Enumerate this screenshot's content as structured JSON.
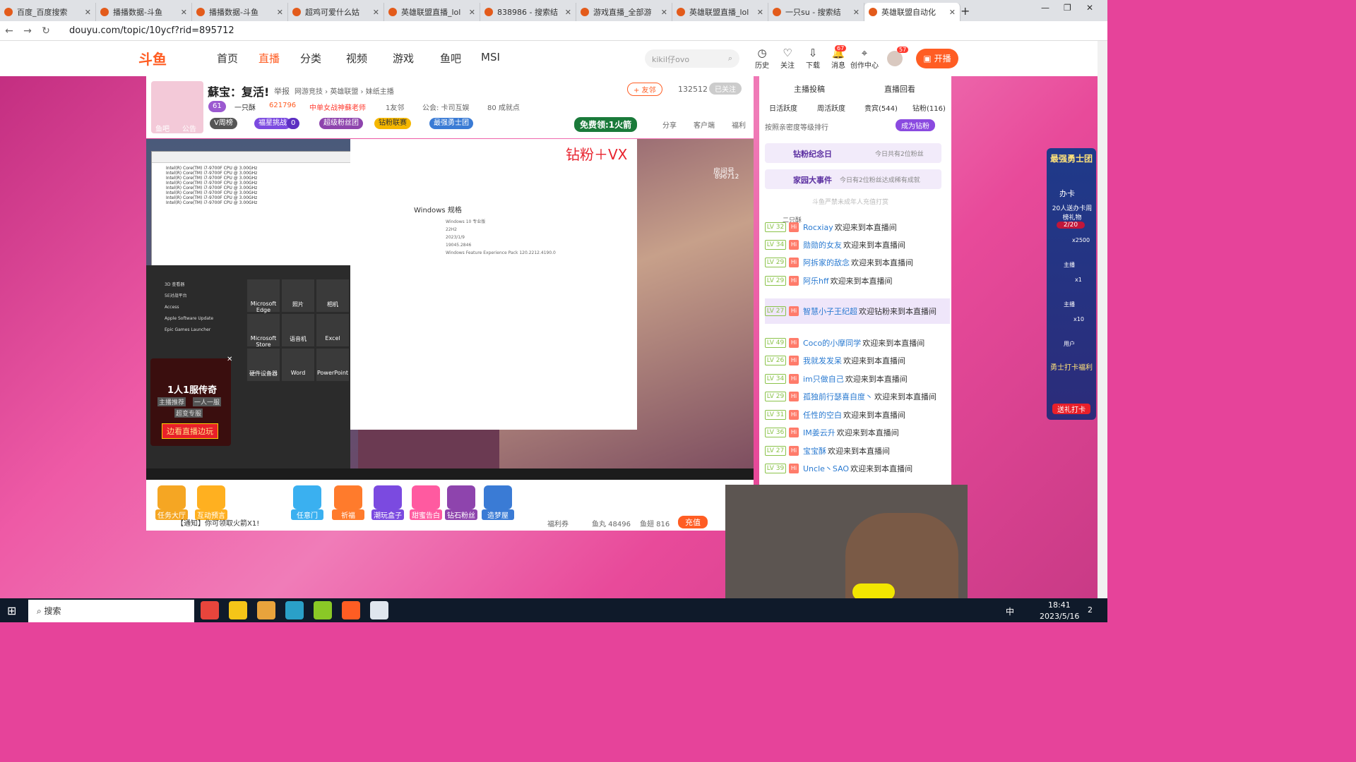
{
  "browser": {
    "tabs": [
      {
        "label": "百度_百度搜索"
      },
      {
        "label": "播播数据-斗鱼"
      },
      {
        "label": "播播数据-斗鱼"
      },
      {
        "label": "超鸡可爱什么姑"
      },
      {
        "label": "英雄联盟直播_lol"
      },
      {
        "label": "838986 - 搜索结"
      },
      {
        "label": "游戏直播_全部游"
      },
      {
        "label": "英雄联盟直播_lol"
      },
      {
        "label": "一只su - 搜索结"
      },
      {
        "label": "英雄联盟自动化"
      }
    ],
    "url": "douyu.com/topic/10ycf?rid=895712"
  },
  "topnav": {
    "logo": "斗鱼",
    "items": [
      "首页",
      "直播",
      "分类",
      "视频",
      "游戏",
      "鱼吧",
      "MSI"
    ],
    "search_placeholder": "kikiI仔ovo",
    "icons": [
      {
        "label": "历史"
      },
      {
        "label": "关注"
      },
      {
        "label": "下载"
      },
      {
        "label": "消息",
        "badge": "67"
      },
      {
        "label": "创作中心"
      }
    ],
    "avatar_badge": "57",
    "kaibo": "开播"
  },
  "room": {
    "title": "蘇宝：复活!",
    "report": "举报",
    "breadcrumb": "网游竞技 › 英雄联盟 › 妹纸主播",
    "follow_btn": "+ 友邻",
    "follow_count": "132512",
    "followed": "已关注",
    "level": "61",
    "guild": "一只酥",
    "heat": "621796",
    "tag": "中单女战神蘇老师",
    "fans": "1友邻",
    "notice": "公会: 卡司互娱",
    "achieve": "80 成就点",
    "avatar_tags": [
      "鱼吧",
      "公告"
    ],
    "badges": [
      "V周榜",
      "福星挑战",
      "0",
      "超级粉丝团",
      "钻粉联赛",
      "最强勇士团"
    ],
    "free_btn": "免费领:1火箭",
    "actions": [
      "分享",
      "客户端",
      "福利"
    ]
  },
  "video": {
    "overlay_text": "钻粉＋VX",
    "room_no_label": "房间号",
    "room_no": "896712",
    "promo_title": "1人1服传奇",
    "promo_tags": [
      "主播推荐",
      "一人一服",
      "超变专服"
    ],
    "promo_btn": "边看直播边玩",
    "win_specs_title": "Windows 规格",
    "win_specs": [
      "Windows 10 专业版",
      "22H2",
      "2023/1/9",
      "19045.2846",
      "Windows Feature Experience Pack 120.2212.4190.0"
    ],
    "start_tiles": [
      "Microsoft Edge",
      "照片",
      "相机",
      "Microsoft Store",
      "语音机",
      "Excel",
      "硬件设备器",
      "Word",
      "PowerPoint"
    ],
    "start_list": [
      "3D 查看器",
      "5E对战平台",
      "Access",
      "Apple Software Update",
      "Epic Games Launcher"
    ],
    "cpu_items": [
      "Intel(R) Core(TM) i7-9700F CPU @ 3.00GHz"
    ]
  },
  "toolbar": {
    "items": [
      "任务大厅",
      "互动预言",
      "任意门",
      "祈福",
      "潮玩盒子",
      "甜蜜告白",
      "钻石粉丝",
      "造梦屋"
    ],
    "notice": "【通知】你可领取火箭X1!",
    "welfare": "福利券",
    "fishball": "鱼丸 48496",
    "fishfin": "鱼翅 816",
    "recharge": "充值"
  },
  "panel": {
    "tabs_top": [
      "主播投稿",
      "直播回看"
    ],
    "tabs": [
      "日活跃度",
      "周活跃度",
      "贵宾(544)",
      "钻粉(116)"
    ],
    "sort_label": "按照亲密度等级排行",
    "become": "成为钻粉",
    "memorial": "钻粉纪念日",
    "memorial_note": "今日共有2位粉丝",
    "family": "家园大事件",
    "family_note": "今日有2位粉丝达成稀有成就",
    "warning": "斗鱼严禁未成年人充值打赏",
    "rank_user": "二只酥",
    "chat": [
      {
        "lv": "LV 32",
        "name": "Rocxiay",
        "msg": "欢迎来到本直播间"
      },
      {
        "lv": "LV 34",
        "name": "勋勋的女友",
        "msg": "欢迎来到本直播间"
      },
      {
        "lv": "LV 29",
        "name": "阿拆家的敌念",
        "msg": "欢迎来到本直播间"
      },
      {
        "lv": "LV 29",
        "name": "阿乐hff",
        "msg": "欢迎来到本直播间"
      },
      {
        "lv": "LV 27",
        "name": "智慧小子王纪超",
        "msg": "欢迎钻粉来到本直播间"
      },
      {
        "lv": "LV 49",
        "name": "Coco的小摩同学",
        "msg": "欢迎来到本直播间"
      },
      {
        "lv": "LV 26",
        "name": "我就发发呆",
        "msg": "欢迎来到本直播间"
      },
      {
        "lv": "LV 34",
        "name": "im只做自己",
        "msg": "欢迎来到本直播间"
      },
      {
        "lv": "LV 29",
        "name": "孤独前行瑟喜自度丶",
        "msg": "欢迎来到本直播间"
      },
      {
        "lv": "LV 31",
        "name": "任性的空白",
        "msg": "欢迎来到本直播间"
      },
      {
        "lv": "LV 36",
        "name": "IM姜云升",
        "msg": "欢迎来到本直播间"
      },
      {
        "lv": "LV 27",
        "name": "宝宝酥",
        "msg": "欢迎来到本直播间"
      },
      {
        "lv": "LV 39",
        "name": "Uncle丶SAO",
        "msg": "欢迎来到本直播间"
      }
    ]
  },
  "side": {
    "title": "最强勇士团",
    "card": "办卡",
    "promo": "20人送办卡周榜礼物",
    "progress": "2/20",
    "badges": [
      "x2500",
      "x1",
      "x10"
    ],
    "labels": [
      "主播",
      "主播",
      "用户"
    ],
    "welfare": "勇士打卡福利",
    "checkin": "送礼打卡"
  },
  "taskbar": {
    "search": "搜索",
    "time": "18:41",
    "date": "2023/5/16",
    "ime": "中",
    "notify": "2"
  }
}
